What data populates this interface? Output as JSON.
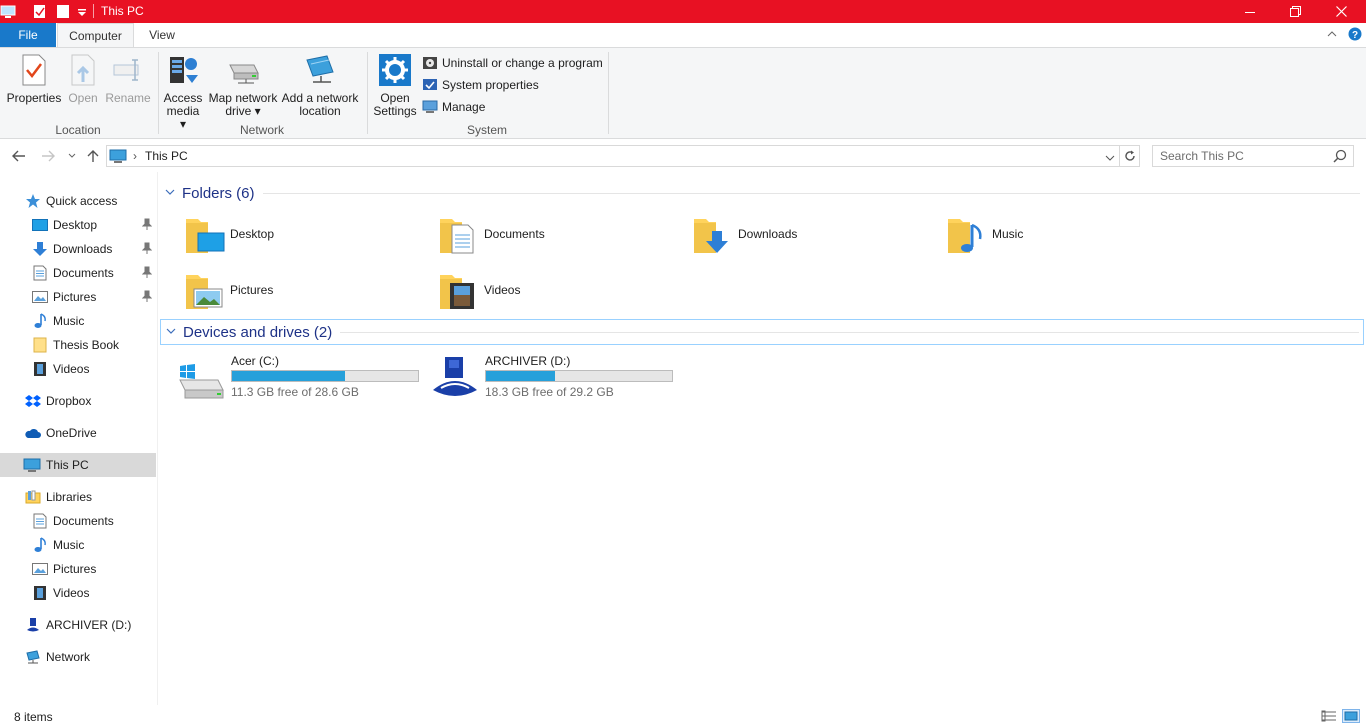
{
  "window": {
    "title": "This PC",
    "controls": {
      "minimize": "–",
      "restore": "❐",
      "close": "✕"
    }
  },
  "ribbon_tabs": {
    "file": "File",
    "computer": "Computer",
    "view": "View"
  },
  "ribbon": {
    "location": {
      "label": "Location",
      "properties": "Properties",
      "open": "Open",
      "rename": "Rename"
    },
    "network": {
      "label": "Network",
      "access_media_1": "Access",
      "access_media_2": "media ▾",
      "map_drive_1": "Map network",
      "map_drive_2": "drive ▾",
      "add_location_1": "Add a network",
      "add_location_2": "location"
    },
    "system": {
      "label": "System",
      "open_settings_1": "Open",
      "open_settings_2": "Settings",
      "uninstall": "Uninstall or change a program",
      "system_properties": "System properties",
      "manage": "Manage"
    }
  },
  "address": {
    "crumb": "This PC",
    "separator": "›"
  },
  "search": {
    "placeholder": "Search This PC"
  },
  "sidebar": {
    "items": [
      {
        "label": "Quick access",
        "icon": "star-icon"
      },
      {
        "label": "Desktop",
        "icon": "desktop-folder-icon",
        "pinned": true
      },
      {
        "label": "Downloads",
        "icon": "download-arrow-icon",
        "pinned": true
      },
      {
        "label": "Documents",
        "icon": "document-icon",
        "pinned": true
      },
      {
        "label": "Pictures",
        "icon": "picture-icon",
        "pinned": true
      },
      {
        "label": "Music",
        "icon": "music-note-icon"
      },
      {
        "label": "Thesis Book",
        "icon": "folder-icon"
      },
      {
        "label": "Videos",
        "icon": "film-icon"
      },
      {
        "label": "Dropbox",
        "icon": "dropbox-icon"
      },
      {
        "label": "OneDrive",
        "icon": "cloud-icon"
      },
      {
        "label": "This PC",
        "icon": "computer-icon",
        "selected": true
      },
      {
        "label": "Libraries",
        "icon": "libraries-icon"
      },
      {
        "label": "Documents",
        "icon": "document-icon"
      },
      {
        "label": "Music",
        "icon": "music-note-icon"
      },
      {
        "label": "Pictures",
        "icon": "picture-icon"
      },
      {
        "label": "Videos",
        "icon": "film-icon"
      },
      {
        "label": "ARCHIVER (D:)",
        "icon": "archiver-drive-icon"
      },
      {
        "label": "Network",
        "icon": "network-icon"
      }
    ]
  },
  "folders_section": {
    "header": "Folders (6)",
    "folders": [
      {
        "label": "Desktop"
      },
      {
        "label": "Documents"
      },
      {
        "label": "Downloads"
      },
      {
        "label": "Music"
      },
      {
        "label": "Pictures"
      },
      {
        "label": "Videos"
      }
    ]
  },
  "drives_section": {
    "header": "Devices and drives (2)",
    "drives": [
      {
        "name": "Acer (C:)",
        "free_text": "11.3 GB free of 28.6 GB",
        "used_fraction": 0.605
      },
      {
        "name": "ARCHIVER (D:)",
        "free_text": "18.3 GB free of 29.2 GB",
        "used_fraction": 0.373
      }
    ]
  },
  "status": {
    "count": "8 items"
  },
  "colors": {
    "titlebar": "#e81123",
    "file_tab": "#1979ca",
    "drive_bar": "#26a0da",
    "section_header": "#1e3287"
  }
}
